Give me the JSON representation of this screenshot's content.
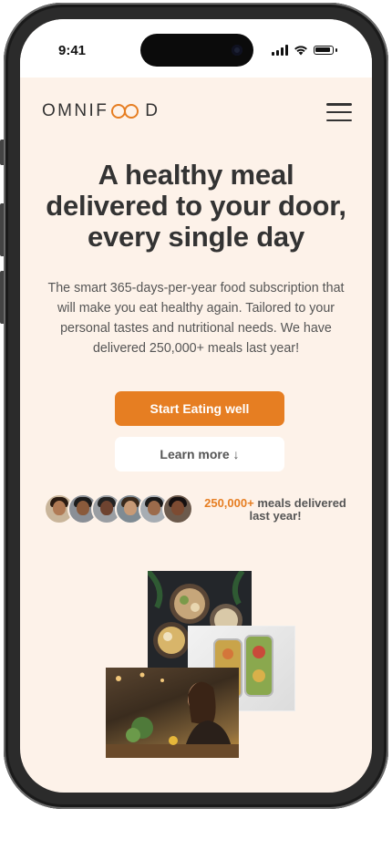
{
  "status_bar": {
    "time": "9:41"
  },
  "nav": {
    "logo_left": "OMNIF",
    "logo_right": "D",
    "menu_icon": "hamburger-icon"
  },
  "hero": {
    "title": "A healthy meal delivered to your door, every single day",
    "description": "The smart 365-days-per-year food subscription that will make you eat healthy again. Tailored to your personal tastes and nutritional needs. We have delivered 250,000+ meals last year!",
    "primary_button": "Start Eating well",
    "secondary_button": "Learn more ↓"
  },
  "delivered": {
    "count": "250,000+",
    "text": " meals delivered last year!"
  },
  "colors": {
    "accent": "#e67e22",
    "background": "#fdf2e9",
    "text_dark": "#333333"
  }
}
